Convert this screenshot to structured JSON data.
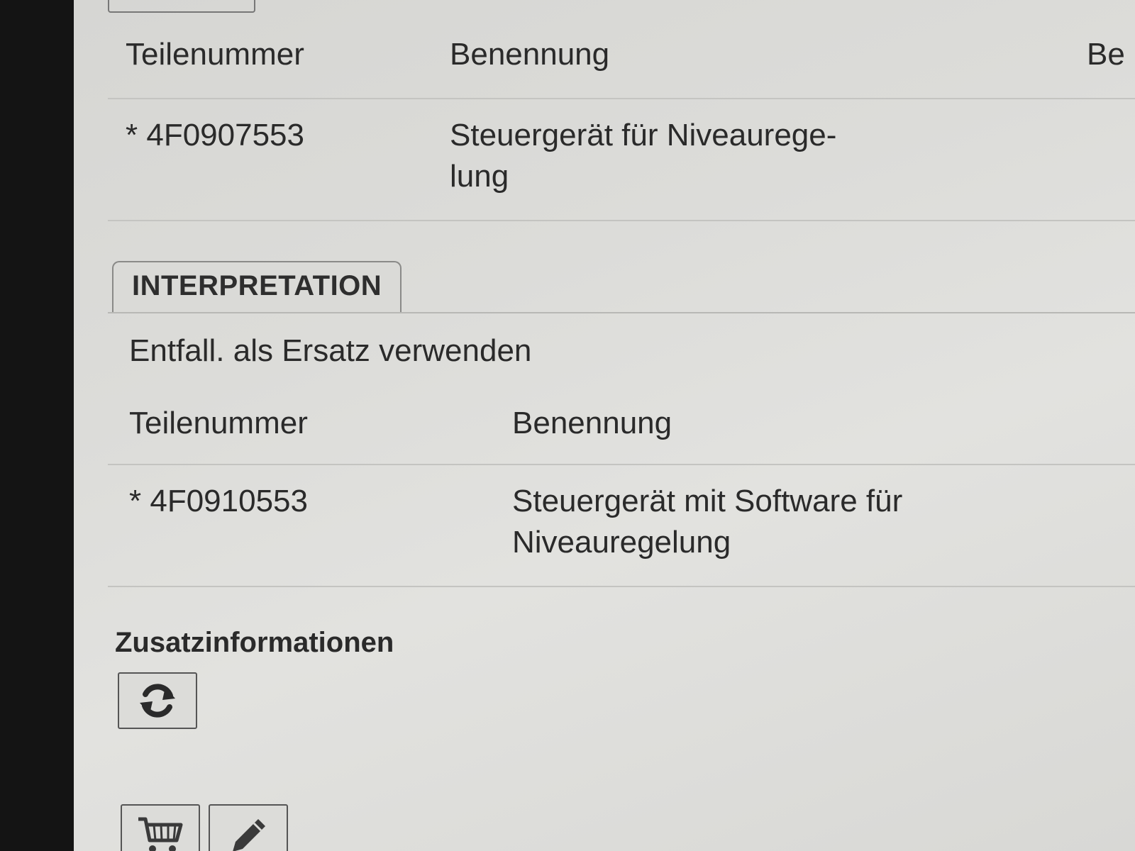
{
  "table1": {
    "headers": {
      "part_number": "Teilenummer",
      "name": "Benennung",
      "extra": "Be"
    },
    "row": {
      "part_number": "* 4F0907553",
      "name_line1": "Steuergerät für Niveaurege-",
      "name_line2": "lung"
    }
  },
  "interpretation": {
    "tab_label": "INTERPRETATION",
    "subtitle": "Entfall. als Ersatz verwenden",
    "headers": {
      "part_number": "Teilenummer",
      "name": "Benennung"
    },
    "row": {
      "part_number": "* 4F0910553",
      "name_line1": "Steuergerät mit Software für",
      "name_line2": "Niveauregelung"
    }
  },
  "additional_info": {
    "heading": "Zusatzinformationen",
    "refresh_icon": "refresh-icon"
  },
  "actions": {
    "cart_icon": "cart-icon",
    "edit_icon": "pencil-icon"
  }
}
